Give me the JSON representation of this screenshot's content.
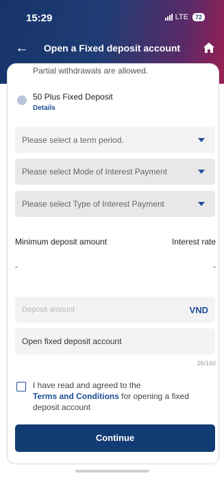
{
  "status": {
    "time": "15:29",
    "network": "LTE",
    "battery": "72"
  },
  "nav": {
    "title": "Open a Fixed deposit account",
    "back_icon": "arrow-left-icon",
    "home_icon": "home-icon"
  },
  "product": {
    "partial_text": "Partial withdrawals are allowed.",
    "name": "50 Plus Fixed Deposit",
    "details_label": "Details"
  },
  "selects": {
    "term": "Please select a term period.",
    "interest_mode": "Please select Mode of Interest Payment",
    "interest_type": "Please select Type of Interest Payment"
  },
  "info": {
    "min_label": "Minimum deposit amount",
    "rate_label": "Interest rate",
    "min_value": "-",
    "rate_value": "-"
  },
  "amount": {
    "placeholder": "Deposit amount",
    "currency": "VND"
  },
  "account_name": {
    "value": "Open fixed deposit account",
    "counter": "26/160"
  },
  "agreement": {
    "line1": "I have read and agreed to the",
    "terms_link": "Terms and Conditions",
    "line2_rest": " for opening a fixed",
    "line3": "deposit account"
  },
  "continue_label": "Continue",
  "colors": {
    "primary": "#123d74",
    "link": "#1b4e96",
    "header_start": "#16346a",
    "header_end": "#9a1f52"
  }
}
